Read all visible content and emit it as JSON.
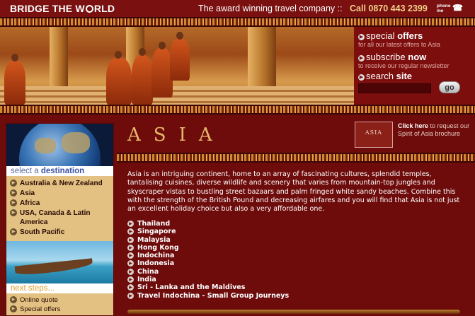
{
  "header": {
    "logo_text_1": "BRIDGE THE W",
    "logo_text_2": "RLD",
    "tagline": "The award winning travel company ::",
    "call": "Call 0870 443 2399",
    "phone_me_1": "phone",
    "phone_me_2": "me"
  },
  "promo": {
    "special_offers_a": "special ",
    "special_offers_b": "offers",
    "special_offers_sub": "for all our latest offers to Asia",
    "subscribe_a": "subscribe ",
    "subscribe_b": "now",
    "subscribe_sub": "to receive our regular newsletter",
    "search_a": "search ",
    "search_b": "site",
    "search_value": "",
    "go_label": "go"
  },
  "sidebar": {
    "select_a": "select a ",
    "select_b": "destination",
    "destinations": [
      {
        "label": "Australia & New Zealand"
      },
      {
        "label": "Asia"
      },
      {
        "label": "Africa"
      },
      {
        "label": "USA, Canada & Latin America"
      },
      {
        "label": "South Pacific"
      }
    ],
    "next_steps": "next steps...",
    "next_items": [
      {
        "label": "Online quote"
      },
      {
        "label": "Special offers"
      }
    ]
  },
  "main": {
    "title": "ASIA",
    "brochure_thumb": "ASIA",
    "brochure_click": "Click here",
    "brochure_rest": " to request our Spirit of Asia brochure",
    "intro": "Asia is an intriguing continent, home to an array of fascinating cultures, splendid temples, tantalising cuisines, diverse wildlife and scenery that varies from mountain-top jungles and skyscraper vistas to bustling street bazaars and palm fringed white sandy beaches. Combine this with the strength of the British Pound and decreasing airfares and you will find that Asia is not just an excellent holiday choice but also a very affordable one.",
    "countries": [
      {
        "label": "Thailand"
      },
      {
        "label": "Singapore"
      },
      {
        "label": "Malaysia"
      },
      {
        "label": "Hong Kong"
      },
      {
        "label": "Indochina"
      },
      {
        "label": "Indonesia"
      },
      {
        "label": "China"
      },
      {
        "label": "India"
      },
      {
        "label": "Sri - Lanka and the Maldives"
      },
      {
        "label": "Travel Indochina - Small Group Journeys"
      }
    ]
  },
  "colors": {
    "background": "#6e0c0c",
    "gold": "#e6b86a",
    "sidebar": "#e2c182"
  }
}
